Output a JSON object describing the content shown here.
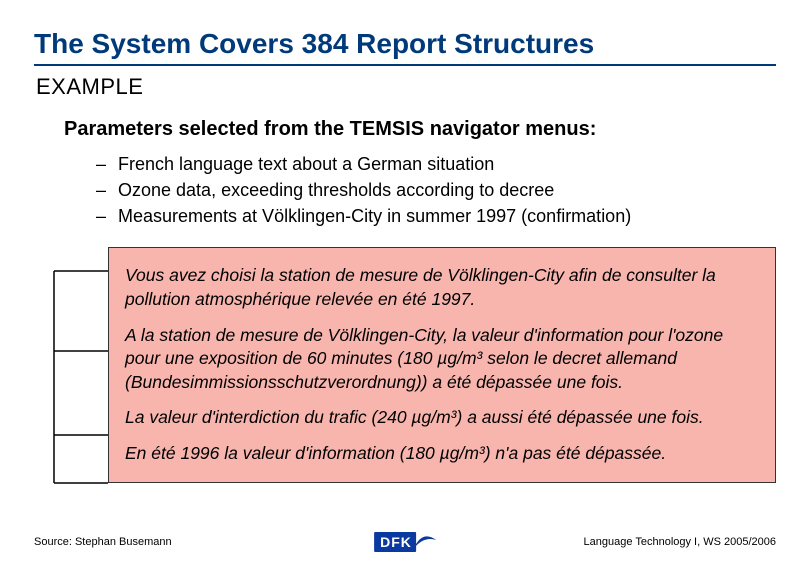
{
  "title": "The System Covers 384 Report Structures",
  "subtitle": "EXAMPLE",
  "section_heading": "Parameters selected from the TEMSIS navigator menus:",
  "bullets": [
    "French language text about a German situation",
    "Ozone data, exceeding thresholds according to decree",
    "Measurements at Völklingen-City in summer 1997 (confirmation)"
  ],
  "example_paragraphs": [
    "Vous avez choisi la station de mesure de Völklingen-City afin de consulter la pollution atmosphérique relevée en été 1997.",
    "A la station de mesure de Völklingen-City, la valeur d'information pour l'ozone pour une exposition de 60 minutes (180 µg/m³ selon le decret allemand (Bundesimmissionsschutzverordnung)) a été dépassée une fois.",
    "La valeur d'interdiction du trafic (240 µg/m³) a aussi été dépassée une fois.",
    "En été 1996 la valeur d'information (180 µg/m³) n'a pas été dépassée."
  ],
  "footer": {
    "left": "Source: Stephan Busemann",
    "right": "Language Technology I, WS 2005/2006",
    "logo_text": "DFK"
  },
  "colors": {
    "title_blue": "#003a7a",
    "pink_box": "#f7b5ae",
    "logo_blue": "#0a3aa0"
  }
}
